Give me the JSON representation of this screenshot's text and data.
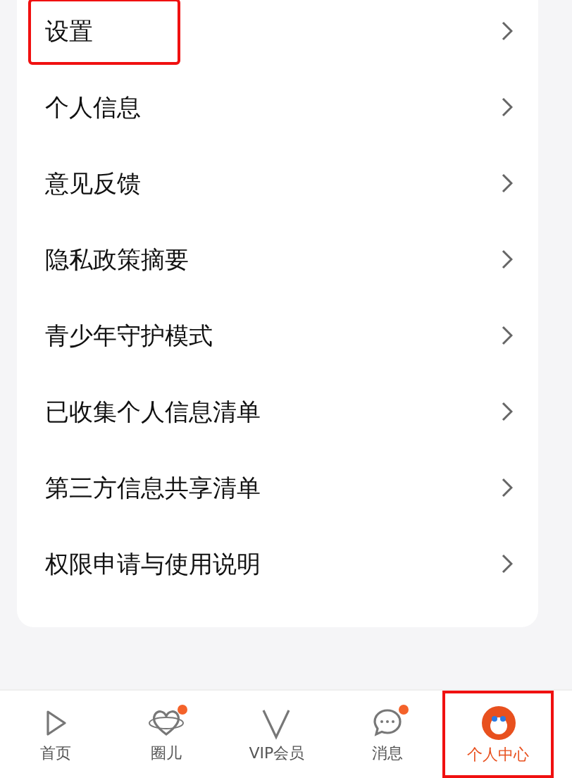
{
  "menu": [
    {
      "label": "设置",
      "highlighted": true
    },
    {
      "label": "个人信息",
      "highlighted": false
    },
    {
      "label": "意见反馈",
      "highlighted": false
    },
    {
      "label": "隐私政策摘要",
      "highlighted": false
    },
    {
      "label": "青少年守护模式",
      "highlighted": false
    },
    {
      "label": "已收集个人信息清单",
      "highlighted": false
    },
    {
      "label": "第三方信息共享清单",
      "highlighted": false
    },
    {
      "label": "权限申请与使用说明",
      "highlighted": false
    }
  ],
  "tab_bar": [
    {
      "kind": "home",
      "label": "首页",
      "badge": false,
      "selected": false,
      "highlighted": false
    },
    {
      "kind": "circle",
      "label": "圈儿",
      "badge": true,
      "selected": false,
      "highlighted": false
    },
    {
      "kind": "vip",
      "label": "VIP会员",
      "badge": false,
      "selected": false,
      "highlighted": false
    },
    {
      "kind": "message",
      "label": "消息",
      "badge": true,
      "selected": false,
      "highlighted": false
    },
    {
      "kind": "profile",
      "label": "个人中心",
      "badge": false,
      "selected": true,
      "highlighted": true
    }
  ]
}
